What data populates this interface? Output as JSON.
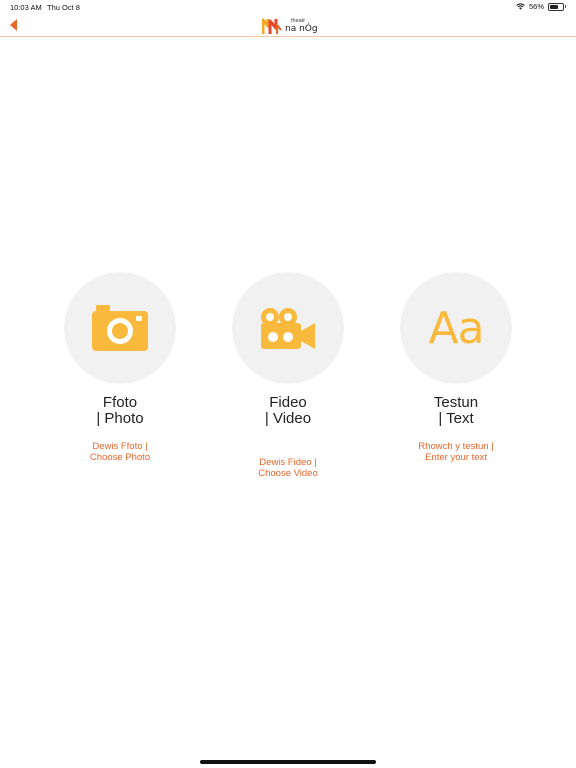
{
  "status_bar": {
    "time": "10:03 AM",
    "date": "Thu Oct 8",
    "battery": "56%"
  },
  "nav": {
    "logo_top": "theatr",
    "logo_bottom": "na nÓg"
  },
  "options": [
    {
      "title_line1": "Ffoto",
      "title_line2": "| Photo",
      "subtitle_line1": "Dewis Ffoto  |",
      "subtitle_line2": "Choose  Photo",
      "icon": "camera-icon"
    },
    {
      "title_line1": "Fideo",
      "title_line2": "| Video",
      "subtitle_line1": "Dewis Fideo  |",
      "subtitle_line2": "Choose Video",
      "icon": "video-camera-icon"
    },
    {
      "title_line1": "Testun",
      "title_line2": "| Text",
      "subtitle_line1": "Rhowch y testun |",
      "subtitle_line2": "Enter your text",
      "icon": "text-aa-icon",
      "icon_glyph": "Aa"
    }
  ],
  "colors": {
    "accent_orange": "#e8672b",
    "icon_yellow": "#f9b93c",
    "circle_bg": "#f2f1f1"
  }
}
